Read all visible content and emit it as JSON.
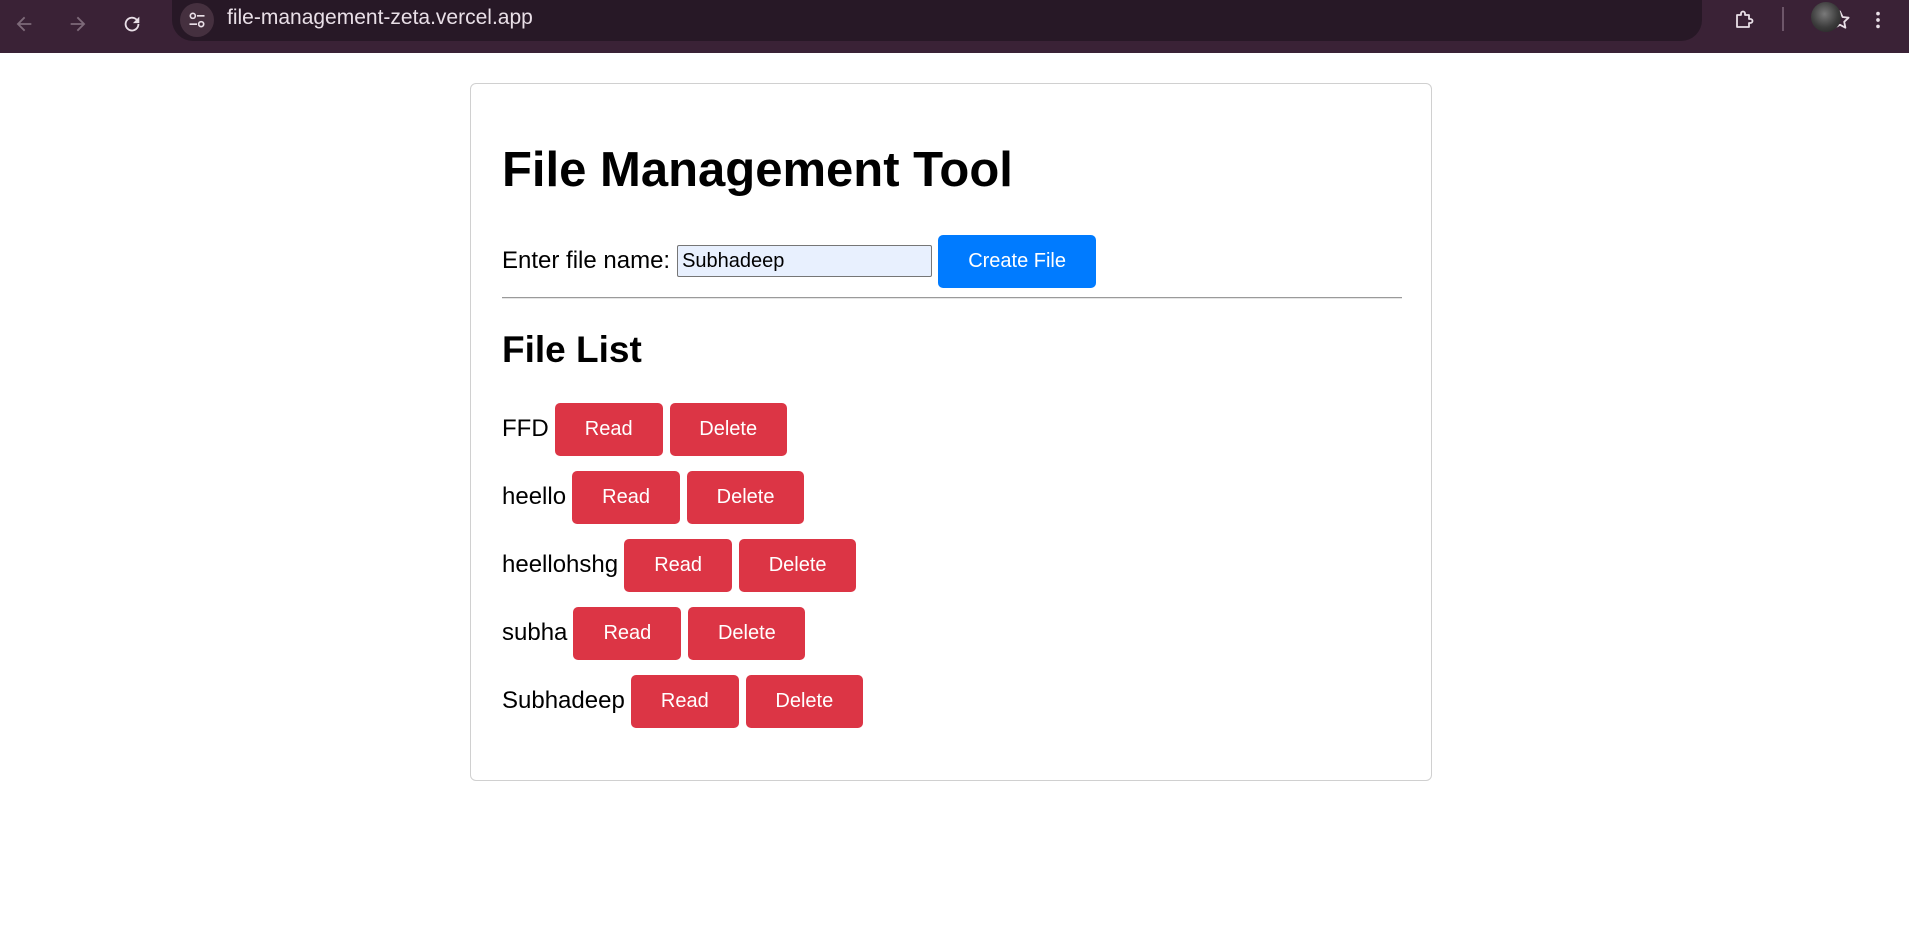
{
  "browser": {
    "url": "file-management-zeta.vercel.app",
    "icons": {
      "back": "arrow-left-icon",
      "forward": "arrow-right-icon",
      "reload": "reload-icon",
      "site_info": "tune-icon",
      "bookmark": "star-icon",
      "extensions": "puzzle-icon",
      "menu": "kebab-menu-icon"
    }
  },
  "page": {
    "title": "File Management Tool",
    "create": {
      "label": "Enter file name:",
      "input_value": "Subhadeep",
      "button_label": "Create File"
    },
    "list_title": "File List",
    "read_label": "Read",
    "delete_label": "Delete",
    "files": [
      {
        "name": "FFD"
      },
      {
        "name": "heello"
      },
      {
        "name": "heellohshg"
      },
      {
        "name": "subha"
      },
      {
        "name": "Subhadeep"
      }
    ]
  },
  "colors": {
    "browser_chrome": "#3a2236",
    "primary_button": "#007bff",
    "danger_button": "#dc3545",
    "input_autofill_bg": "#e8f0fe"
  }
}
